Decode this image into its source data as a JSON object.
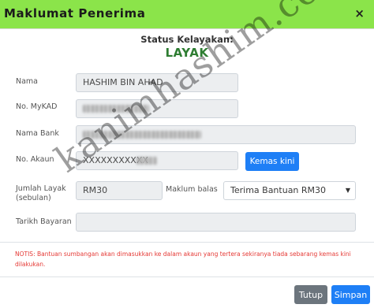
{
  "header": {
    "title": "Maklumat Penerima",
    "close_glyph": "×"
  },
  "status": {
    "label": "Status Kelayakan:",
    "value": "LAYAK",
    "value_color": "#2e7d32"
  },
  "form": {
    "nama": {
      "label": "Nama",
      "value": "HASHIM BIN AHAD"
    },
    "mykad": {
      "label": "No. MyKAD",
      "value": ""
    },
    "bank": {
      "label": "Nama Bank",
      "value": ""
    },
    "akaun": {
      "label": "No. Akaun",
      "value": "XXXXXXXXXXX"
    },
    "kemas_kini_label": "Kemas kini",
    "jumlah": {
      "label_line1": "Jumlah Layak",
      "label_line2": "(sebulan)",
      "value": "RM30"
    },
    "maklum_balas": {
      "label": "Maklum balas",
      "selected": "Terima Bantuan RM30"
    },
    "tarikh": {
      "label": "Tarikh Bayaran",
      "value": ""
    }
  },
  "notis": "NOTIS: Bantuan sumbangan akan dimasukkan ke dalam akaun yang tertera sekiranya tiada sebarang kemas kini dilakukan.",
  "footer": {
    "tutup_label": "Tutup",
    "simpan_label": "Simpan"
  },
  "watermark": "kanimhashim.com",
  "colors": {
    "header_bg": "#8be44a",
    "primary": "#1e7ff6",
    "secondary": "#6c757d",
    "notice": "#e53935"
  }
}
